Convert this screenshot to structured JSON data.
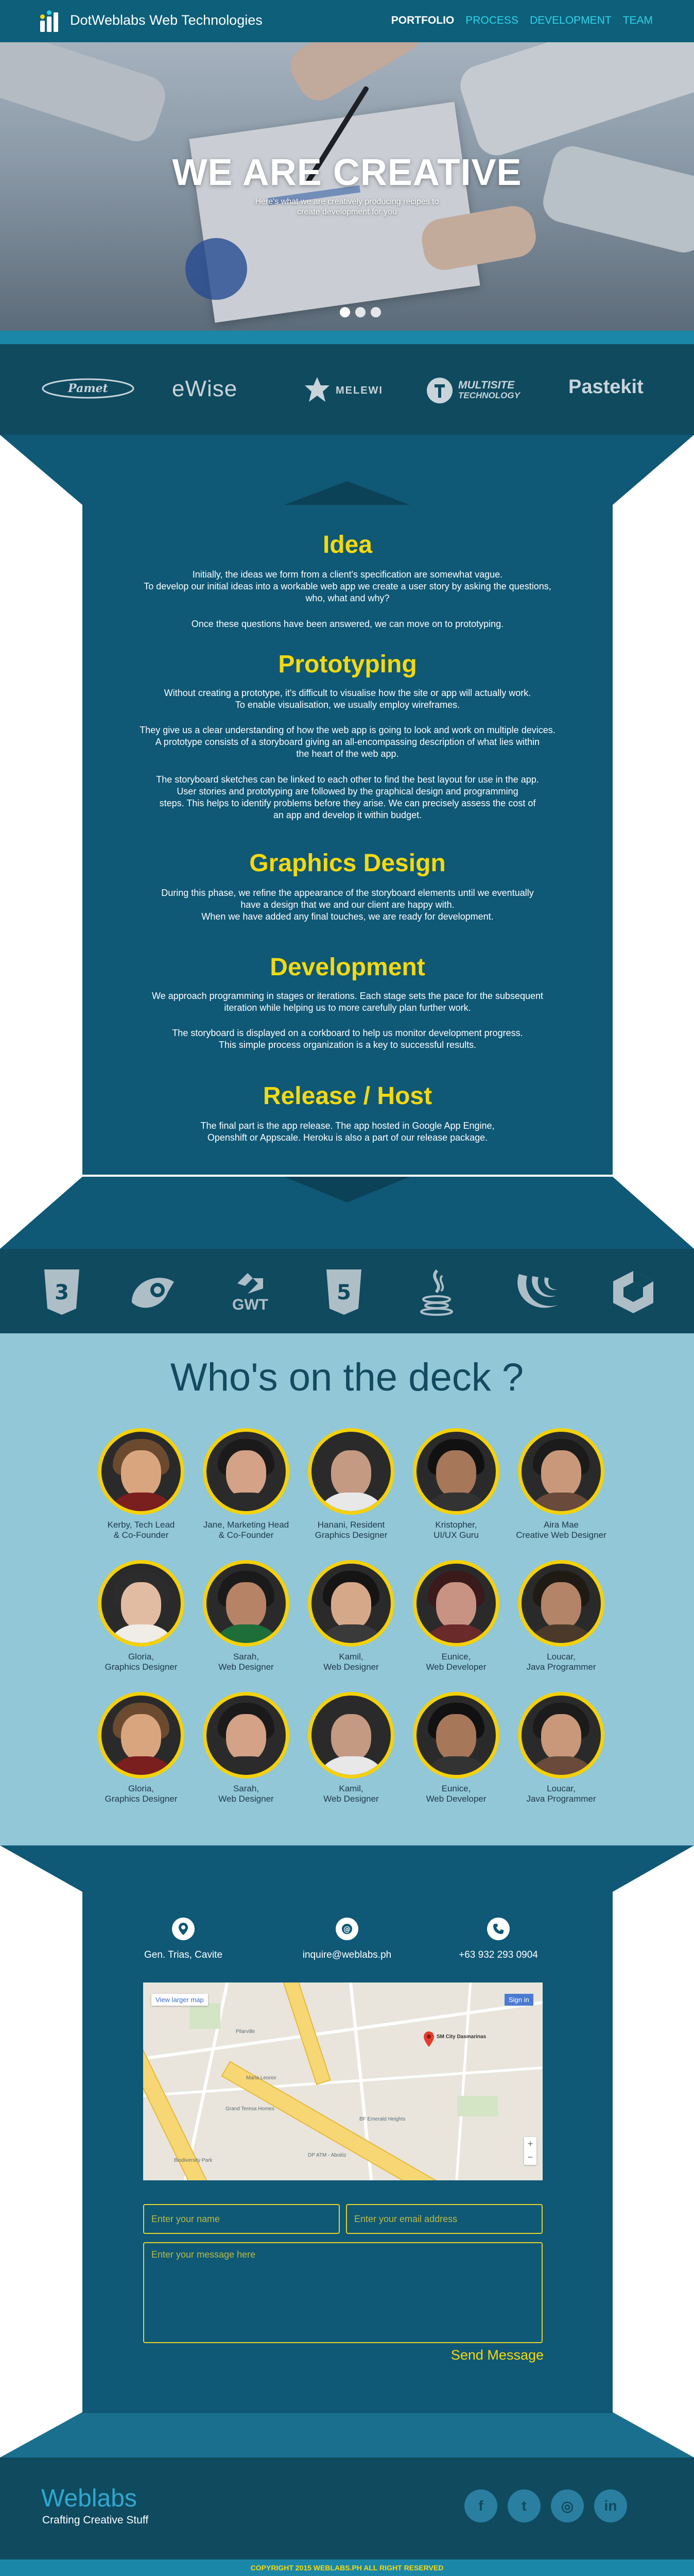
{
  "header": {
    "brand": "DotWeblabs Web Technologies",
    "nav": [
      "PORTFOLIO",
      "PROCESS",
      "DEVELOPMENT",
      "TEAM"
    ]
  },
  "hero": {
    "title": "WE ARE CREATIVE",
    "subtitle_line1": "Here's what we are creatively producing recipes to",
    "subtitle_line2": "create development for you",
    "slides_total": 3,
    "active_slide": 1
  },
  "clients": [
    {
      "name": "Pamet",
      "icon": "pamet-logo"
    },
    {
      "name": "eWise",
      "icon": "ewise-logo"
    },
    {
      "name": "MELEWI",
      "icon": "melewi-logo"
    },
    {
      "name_line1": "MULTISITE",
      "name_line2": "TECHNOLOGY",
      "icon": "multisite-logo"
    },
    {
      "name": "Pastekit",
      "icon": "pastekit-logo"
    }
  ],
  "process": [
    {
      "title": "Idea",
      "paragraphs": [
        [
          "Initially, the ideas we form from a client's specification are somewhat vague.",
          "To develop our initial ideas into a workable web app we create a user story by asking the questions,",
          "who, what and why?"
        ],
        [
          "Once these questions have been answered, we can move on to prototyping."
        ]
      ]
    },
    {
      "title": "Prototyping",
      "paragraphs": [
        [
          "Without creating a prototype, it's difficult to visualise how the site or app will actually work.",
          "To enable visualisation, we usually employ wireframes."
        ],
        [
          "They give us a clear understanding of how the web app is going to look and work on multiple devices.",
          "A prototype consists of a storyboard giving an all-encompassing description of what lies within",
          "the heart of the web app."
        ],
        [
          "The storyboard sketches can be linked to each other to find the best layout for use in the app.",
          "User stories and prototyping are followed by the graphical design and programming",
          "steps. This helps to identify problems before they arise. We can precisely assess the cost of",
          "an app and develop it within budget."
        ]
      ]
    },
    {
      "title": "Graphics Design",
      "paragraphs": [
        [
          "During this phase, we refine the appearance of the storyboard elements until we eventually",
          "have a design that we and our client are happy with.",
          "When we have added any final touches, we are ready for development."
        ]
      ]
    },
    {
      "title": "Development",
      "paragraphs": [
        [
          "We approach programming in stages or iterations. Each stage sets the pace for the subsequent",
          "iteration while helping us to more carefully plan further work."
        ],
        [
          "The storyboard is displayed on a corkboard to help us monitor development progress.",
          "This simple process organization is a key to successful results."
        ]
      ]
    },
    {
      "title": "Release / Host",
      "paragraphs": [
        [
          "The final part is the app release. The app hosted in Google App Engine,",
          "Openshift or Appscale. Heroku is also a part of our release package."
        ]
      ]
    }
  ],
  "tech": [
    {
      "icon": "css3-icon"
    },
    {
      "icon": "grunt-icon"
    },
    {
      "icon": "gwt-icon",
      "label": "GWT"
    },
    {
      "icon": "html5-icon"
    },
    {
      "icon": "java-icon"
    },
    {
      "icon": "jquery-icon"
    },
    {
      "icon": "angular-icon"
    }
  ],
  "team": {
    "title": "Who's on the deck ?",
    "members": [
      {
        "name": "Kerby, Tech Lead",
        "role": "& Co-Founder"
      },
      {
        "name": "Jane, Marketing Head",
        "role": "& Co-Founder"
      },
      {
        "name": "Hanani, Resident",
        "role": "Graphics Designer"
      },
      {
        "name": "Kristopher,",
        "role": "UI/UX Guru"
      },
      {
        "name": "Aira Mae",
        "role": "Creative Web Designer"
      },
      {
        "name": "Gloria,",
        "role": "Graphics Designer"
      },
      {
        "name": "Sarah,",
        "role": "Web Designer"
      },
      {
        "name": "Kamil,",
        "role": "Web Designer"
      },
      {
        "name": "Eunice,",
        "role": "Web Developer"
      },
      {
        "name": "Loucar,",
        "role": "Java Programmer"
      },
      {
        "name": "Gloria,",
        "role": "Graphics Designer"
      },
      {
        "name": "Sarah,",
        "role": "Web Designer"
      },
      {
        "name": "Kamil,",
        "role": "Web Designer"
      },
      {
        "name": "Eunice,",
        "role": "Web Developer"
      },
      {
        "name": "Loucar,",
        "role": "Java Programmer"
      }
    ]
  },
  "contact": {
    "address": "Gen. Trias, Cavite",
    "email": "inquire@weblabs.ph",
    "phone": "+63 932 293 0904",
    "map": {
      "view_larger": "View larger map",
      "sign_in": "Sign in",
      "marker_label": "SM City Dasmarinas"
    },
    "form": {
      "name_placeholder": "Enter your name",
      "email_placeholder": "Enter your email address",
      "message_placeholder": "Enter your message here",
      "send_label": "Send Message"
    }
  },
  "footer": {
    "brand": "Weblabs",
    "tagline": "Crafting Creative Stuff",
    "social": [
      {
        "icon": "facebook-icon",
        "glyph": "f"
      },
      {
        "icon": "twitter-icon",
        "glyph": "t"
      },
      {
        "icon": "instagram-icon",
        "glyph": "◎"
      },
      {
        "icon": "linkedin-icon",
        "glyph": "in"
      }
    ],
    "copyright": "COPYRIGHT 2015 WEBLABS.PH ALL RIGHT RESERVED"
  },
  "colors": {
    "primary": "#0f5876",
    "dark": "#0f4a5f",
    "accent_yellow": "#f5d90f",
    "accent_cyan": "#2fd3e8",
    "team_bg": "#92c7d8"
  }
}
